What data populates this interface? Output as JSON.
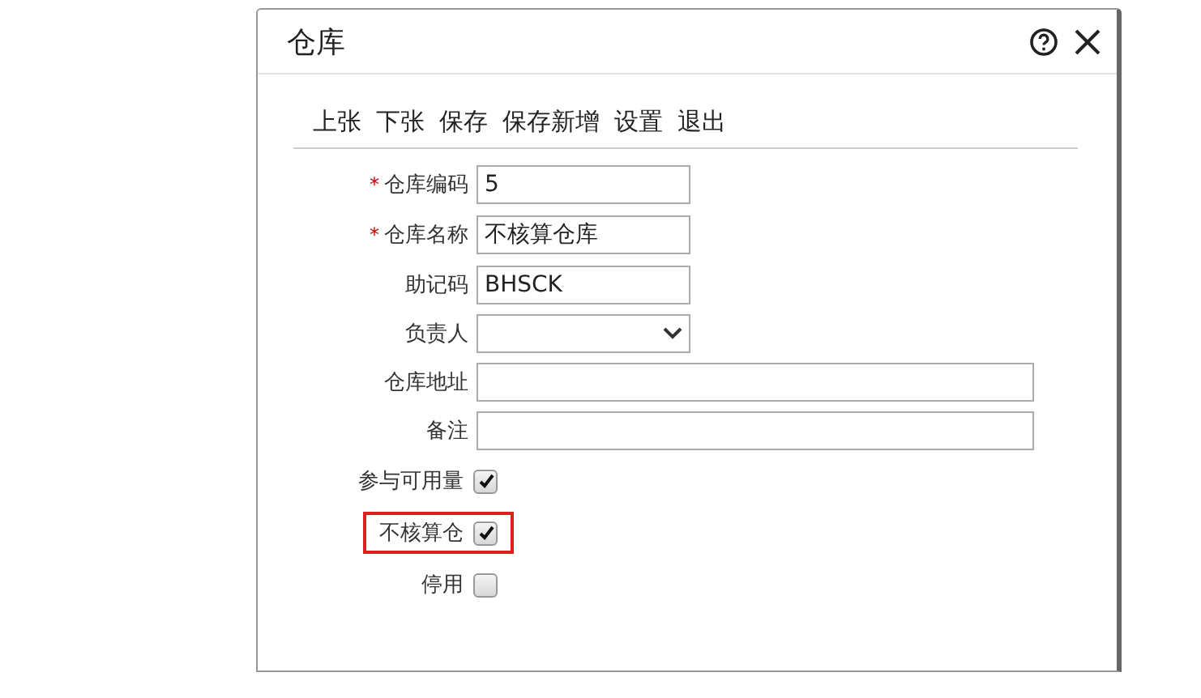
{
  "window": {
    "title": "仓库"
  },
  "toolbar": [
    "上张",
    "下张",
    "保存",
    "保存新增",
    "设置",
    "退出"
  ],
  "fields": [
    {
      "kind": "text",
      "label": "仓库编码",
      "mark": "*",
      "value": "5",
      "wide": false
    },
    {
      "kind": "text",
      "label": "仓库名称",
      "mark": "*",
      "value": "不核算仓库",
      "wide": false
    },
    {
      "kind": "text",
      "label": "助记码",
      "value": "BHSCK",
      "wide": false
    },
    {
      "kind": "select",
      "label": "负责人"
    },
    {
      "kind": "text",
      "label": "仓库地址",
      "wide": true
    },
    {
      "kind": "text",
      "label": "备注",
      "wide": true
    },
    {
      "kind": "checkbox",
      "label": "参与可用量",
      "checked": true,
      "highlighted": false
    },
    {
      "kind": "checkbox",
      "label": "不核算仓",
      "checked": true,
      "highlighted": true
    },
    {
      "kind": "checkbox",
      "label": "停用",
      "checked": false,
      "highlighted": false
    }
  ]
}
